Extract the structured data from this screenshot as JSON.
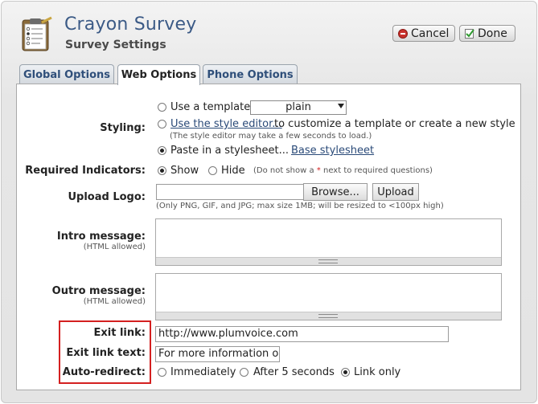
{
  "header": {
    "title": "Crayon Survey",
    "subtitle": "Survey Settings",
    "cancel_label": "Cancel",
    "done_label": "Done"
  },
  "tabs": [
    {
      "label": "Global Options",
      "active": false
    },
    {
      "label": "Web Options",
      "active": true
    },
    {
      "label": "Phone Options",
      "active": false
    }
  ],
  "styling": {
    "label": "Styling:",
    "template_option": "Use a template:",
    "template_selected": "plain",
    "editor_link": "Use the style editor...",
    "editor_suffix": "to customize a template or create a new style",
    "editor_note": "(The style editor may take a few seconds to load.)",
    "stylesheet_option": "Paste in a stylesheet...",
    "base_link": "Base stylesheet",
    "selected": "stylesheet"
  },
  "required": {
    "label": "Required Indicators:",
    "show": "Show",
    "hide": "Hide",
    "note_prefix": "(Do not show a",
    "note_star": "*",
    "note_suffix": "next to required questions)",
    "selected": "show"
  },
  "upload": {
    "label": "Upload Logo:",
    "browse": "Browse...",
    "upload": "Upload",
    "note": "(Only PNG, GIF, and JPG; max size 1MB; will be resized to <100px high)"
  },
  "intro": {
    "label": "Intro message:",
    "sublabel": "(HTML allowed)"
  },
  "outro": {
    "label": "Outro message:",
    "sublabel": "(HTML allowed)"
  },
  "exit": {
    "link_label": "Exit link:",
    "link_value": "http://www.plumvoice.com",
    "text_label": "Exit link text:",
    "text_value": "For more information on P",
    "redirect_label": "Auto-redirect:",
    "opt_immediately": "Immediately",
    "opt_after5": "After 5 seconds",
    "opt_linkonly": "Link only",
    "selected": "link-only"
  },
  "colors": {
    "title": "#3b5a86",
    "highlight": "#d42020",
    "link": "#2a4a78"
  }
}
